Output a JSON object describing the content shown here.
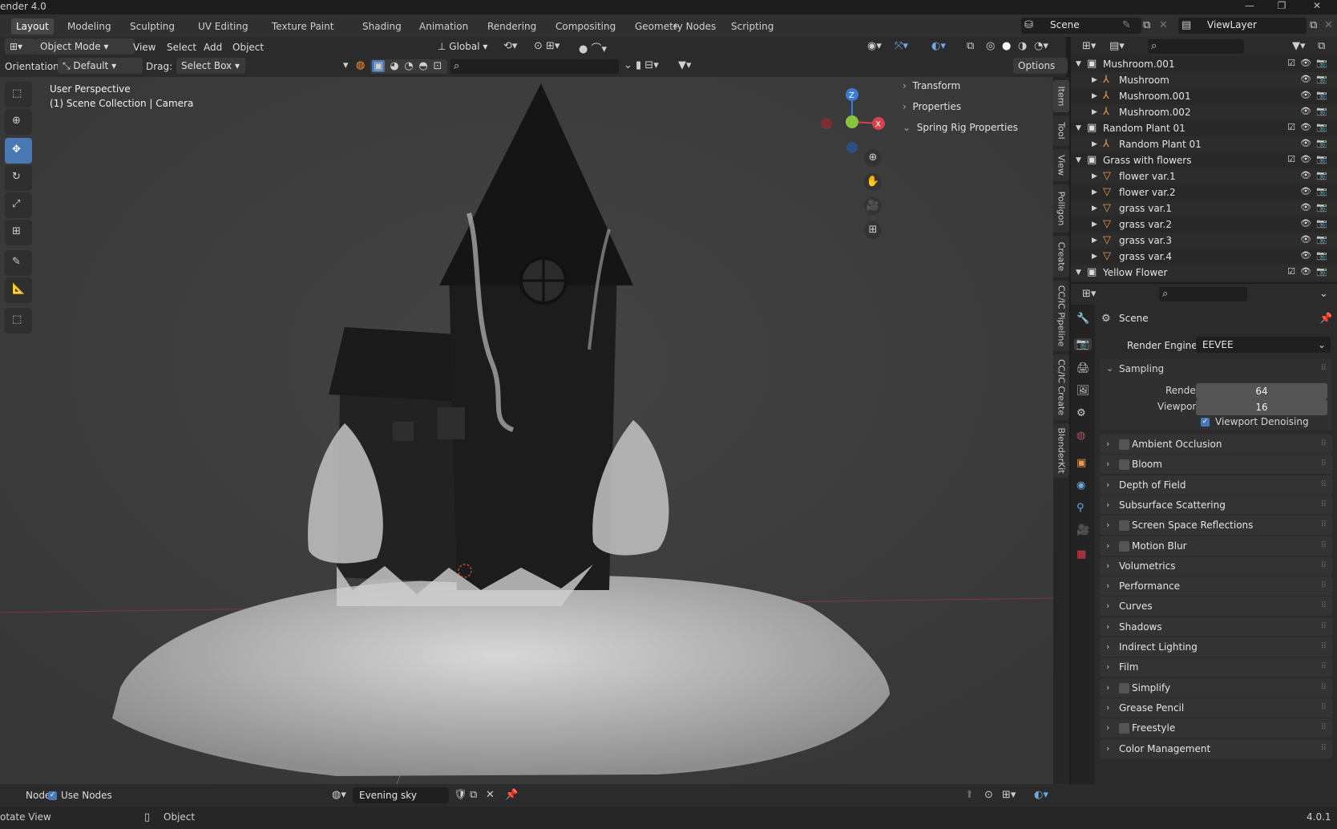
{
  "window": {
    "title": "ender 4.0",
    "controls": [
      "—",
      "❐",
      "✕"
    ]
  },
  "workspaces": {
    "tabs": [
      "Layout",
      "Modeling",
      "Sculpting",
      "UV Editing",
      "Texture Paint",
      "Shading",
      "Animation",
      "Rendering",
      "Compositing",
      "Geometry Nodes",
      "Scripting"
    ],
    "add_label": "+",
    "active": "Layout"
  },
  "scene_selector": {
    "value": "Scene"
  },
  "view_layer": {
    "value": "ViewLayer"
  },
  "header": {
    "mode": "Object Mode",
    "menus": [
      "View",
      "Select",
      "Add",
      "Object"
    ],
    "transform_orientation": "Global",
    "orientation_label": "Orientation:",
    "orientation_value": "Default",
    "drag_label": "Drag:",
    "drag_value": "Select Box",
    "options_label": "Options"
  },
  "viewport": {
    "perspective": "User Perspective",
    "collection_info": "(1) Scene Collection | Camera"
  },
  "sidebar_panels": {
    "items": [
      "Transform",
      "Properties",
      "Spring Rig Properties"
    ]
  },
  "n_panel_tabs": [
    "Item",
    "Tool",
    "View",
    "Polligon",
    "Create",
    "CC/IC Pipeline",
    "CC/IC Create",
    "BlenderKit"
  ],
  "outliner": {
    "rows": [
      {
        "name": "Mushroom.001",
        "indent": 1,
        "type": "collection"
      },
      {
        "name": "Mushroom",
        "indent": 2,
        "type": "armature"
      },
      {
        "name": "Mushroom.001",
        "indent": 2,
        "type": "armature"
      },
      {
        "name": "Mushroom.002",
        "indent": 2,
        "type": "armature"
      },
      {
        "name": "Random Plant 01",
        "indent": 1,
        "type": "collection"
      },
      {
        "name": "Random Plant 01",
        "indent": 2,
        "type": "armature"
      },
      {
        "name": "Grass with flowers",
        "indent": 1,
        "type": "collection"
      },
      {
        "name": "flower var.1",
        "indent": 2,
        "type": "mesh"
      },
      {
        "name": "flower var.2",
        "indent": 2,
        "type": "mesh"
      },
      {
        "name": "grass var.1",
        "indent": 2,
        "type": "mesh"
      },
      {
        "name": "grass var.2",
        "indent": 2,
        "type": "mesh"
      },
      {
        "name": "grass var.3",
        "indent": 2,
        "type": "mesh"
      },
      {
        "name": "grass var.4",
        "indent": 2,
        "type": "mesh"
      },
      {
        "name": "Yellow Flower",
        "indent": 1,
        "type": "collection"
      },
      {
        "name": "Yellow Flower",
        "indent": 2,
        "type": "mesh"
      }
    ]
  },
  "properties": {
    "context": "Scene",
    "render_engine_label": "Render Engine",
    "render_engine_value": "EEVEE",
    "sampling": {
      "title": "Sampling",
      "render_label": "Render",
      "render_value": "64",
      "viewport_label": "Viewport",
      "viewport_value": "16",
      "denoise_label": "Viewport Denoising"
    },
    "panels": [
      {
        "label": "Ambient Occlusion",
        "checkbox": true
      },
      {
        "label": "Bloom",
        "checkbox": true
      },
      {
        "label": "Depth of Field",
        "checkbox": false
      },
      {
        "label": "Subsurface Scattering",
        "checkbox": false
      },
      {
        "label": "Screen Space Reflections",
        "checkbox": true
      },
      {
        "label": "Motion Blur",
        "checkbox": true
      },
      {
        "label": "Volumetrics",
        "checkbox": false
      },
      {
        "label": "Performance",
        "checkbox": false
      },
      {
        "label": "Curves",
        "checkbox": false
      },
      {
        "label": "Shadows",
        "checkbox": false
      },
      {
        "label": "Indirect Lighting",
        "checkbox": false
      },
      {
        "label": "Film",
        "checkbox": false
      },
      {
        "label": "Simplify",
        "checkbox": true
      },
      {
        "label": "Grease Pencil",
        "checkbox": false
      },
      {
        "label": "Freestyle",
        "checkbox": true
      },
      {
        "label": "Color Management",
        "checkbox": false
      }
    ]
  },
  "bottom": {
    "node_label": "Node",
    "use_nodes_label": "Use Nodes",
    "world_name": "Evening sky",
    "status_left": "otate View",
    "status_mid": "Object",
    "version": "4.0.1"
  },
  "colors": {
    "accent": "#4a78b3",
    "axis_x": "#d6414f",
    "axis_y": "#8ac43f",
    "axis_z": "#3b7bd4",
    "mesh_icon": "#e99b45"
  }
}
